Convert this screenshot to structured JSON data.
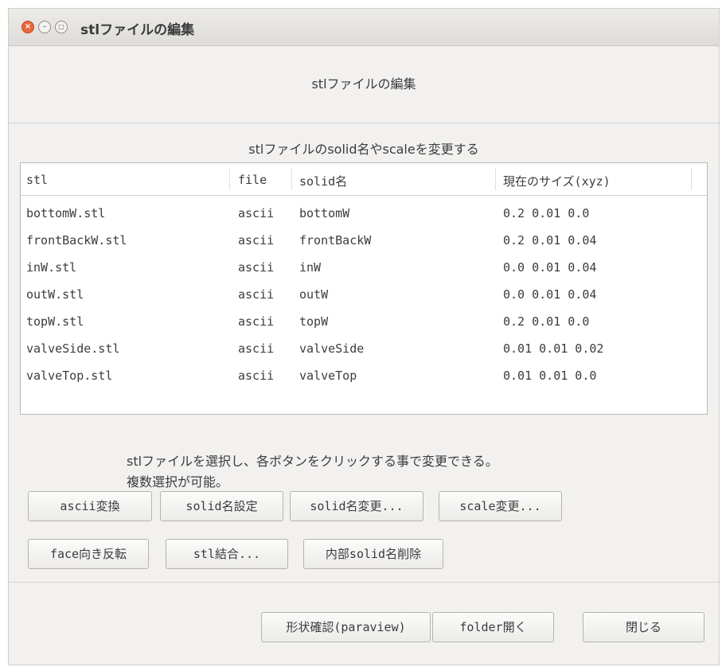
{
  "window": {
    "title": "stlファイルの編集",
    "controls": {
      "close_icon": "×",
      "minimize_icon": "–",
      "maximize_icon": "□"
    }
  },
  "heading": "stlファイルの編集",
  "subheading": "stlファイルのsolid名やscaleを変更する",
  "table": {
    "columns": [
      "stl",
      "file",
      "solid名",
      "現在のサイズ(xyz)"
    ],
    "rows": [
      [
        "bottomW.stl",
        "ascii",
        "bottomW",
        "0.2 0.01 0.0"
      ],
      [
        "frontBackW.stl",
        "ascii",
        "frontBackW",
        "0.2 0.01 0.04"
      ],
      [
        "inW.stl",
        "ascii",
        "inW",
        "0.0 0.01 0.04"
      ],
      [
        "outW.stl",
        "ascii",
        "outW",
        "0.0 0.01 0.04"
      ],
      [
        "topW.stl",
        "ascii",
        "topW",
        "0.2 0.01 0.0"
      ],
      [
        "valveSide.stl",
        "ascii",
        "valveSide",
        "0.01 0.01 0.02"
      ],
      [
        "valveTop.stl",
        "ascii",
        "valveTop",
        "0.01 0.01 0.0"
      ]
    ]
  },
  "instructions": {
    "line1": "stlファイルを選択し、各ボタンをクリックする事で変更できる。",
    "line2": "複数選択が可能。"
  },
  "buttons": {
    "ascii": "ascii変換",
    "solid_set": "solid名設定",
    "solid_change": "solid名変更...",
    "scale": "scale変更...",
    "face_flip": "face向き反転",
    "stl_merge": "stl結合...",
    "remove_inner": "内部solid名削除",
    "paraview": "形状確認(paraview)",
    "folder": "folder開く",
    "close": "閉じる"
  }
}
